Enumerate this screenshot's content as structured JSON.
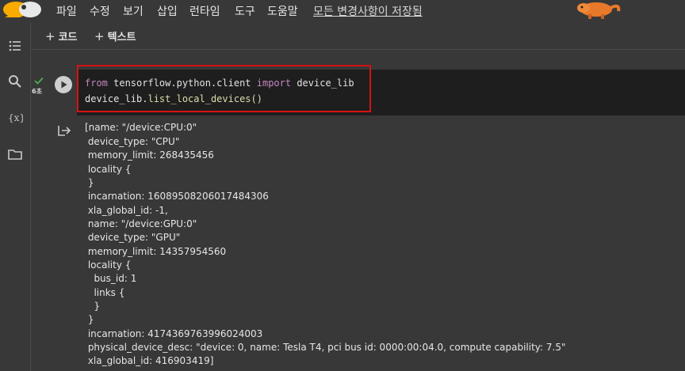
{
  "menu": [
    "파일",
    "수정",
    "보기",
    "삽입",
    "런타임",
    "도구",
    "도움말"
  ],
  "save_status": "모든 변경사항이 저장됨",
  "toolbar": {
    "add_code": "코드",
    "add_text": "텍스트",
    "plus": "+"
  },
  "cell": {
    "exec_time": "6초",
    "code": {
      "line1": {
        "kw_from": "from",
        "module": " tensorflow.python.client ",
        "kw_import": "import",
        "name": " device_lib"
      },
      "line2": {
        "obj": "device_lib.",
        "fn": "list_local_devices",
        "parens": "()"
      }
    }
  },
  "output_lines": [
    "[name: \"/device:CPU:0\"",
    " device_type: \"CPU\"",
    " memory_limit: 268435456",
    " locality {",
    " }",
    " incarnation: 16089508206017484306",
    " xla_global_id: -1,",
    " name: \"/device:GPU:0\"",
    " device_type: \"GPU\"",
    " memory_limit: 14357954560",
    " locality {",
    "   bus_id: 1",
    "   links {",
    "   }",
    " }",
    " incarnation: 4174369763996024003",
    " physical_device_desc: \"device: 0, name: Tesla T4, pci bus id: 0000:00:04.0, compute capability: 7.5\"",
    " xla_global_id: 416903419]"
  ],
  "icons": {
    "logo": "colab-logo",
    "sidebar": [
      "table-of-contents-icon",
      "search-icon",
      "variables-icon",
      "folder-icon"
    ],
    "run": "play-icon",
    "output": "output-redirect-icon",
    "status": "check-icon"
  },
  "colors": {
    "highlight": "#d41313",
    "keyword": "#c586c0",
    "accent_check": "#4caf50"
  }
}
